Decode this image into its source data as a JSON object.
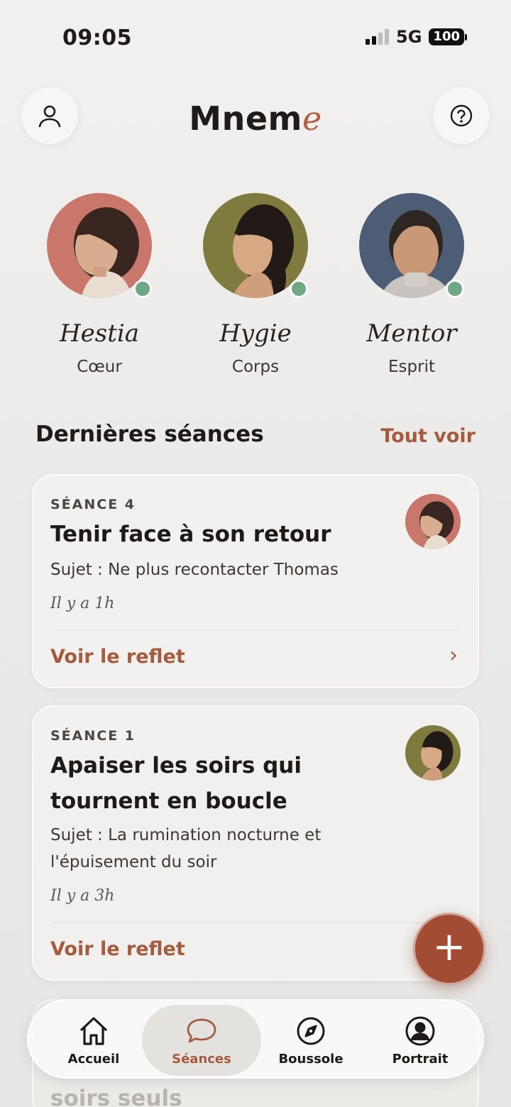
{
  "status_bar": {
    "time": "09:05",
    "network": "5G",
    "battery": "100"
  },
  "header": {
    "title_main": "Mnem",
    "title_accent": "e",
    "profile_icon": "user-icon",
    "help_icon": "help-circle-icon"
  },
  "guides": [
    {
      "name": "Hestia",
      "role": "Cœur",
      "color": "#c9776a",
      "online": true
    },
    {
      "name": "Hygie",
      "role": "Corps",
      "color": "#7f7a3e",
      "online": true
    },
    {
      "name": "Mentor",
      "role": "Esprit",
      "color": "#4d5d75",
      "online": true
    }
  ],
  "sessions_section": {
    "title": "Dernières séances",
    "see_all": "Tout voir"
  },
  "sessions": [
    {
      "kicker": "SÉANCE 4",
      "title": "Tenir face à son retour",
      "subject": "Sujet : Ne plus recontacter Thomas",
      "time": "Il y a 1h",
      "link": "Voir le reflet",
      "guide": "Hestia"
    },
    {
      "kicker": "SÉANCE 1",
      "title": "Apaiser les soirs qui tournent en boucle",
      "subject": "Sujet : La rumination nocturne et l'épuisement du soir",
      "time": "Il y a 3h",
      "link": "Voir le reflet",
      "guide": "Hygie"
    }
  ],
  "peek_card": {
    "title": "soirs seuls"
  },
  "fab": {
    "label": "+",
    "icon": "plus-icon"
  },
  "bottom_nav": {
    "items": [
      {
        "label": "Accueil",
        "icon": "home-icon",
        "active": false
      },
      {
        "label": "Séances",
        "icon": "chat-bubble-icon",
        "active": true
      },
      {
        "label": "Boussole",
        "icon": "compass-icon",
        "active": false
      },
      {
        "label": "Portrait",
        "icon": "profile-circle-icon",
        "active": false
      }
    ]
  },
  "colors": {
    "accent": "#a65a3e",
    "fab": "#a34c34",
    "online": "#6fa886"
  }
}
